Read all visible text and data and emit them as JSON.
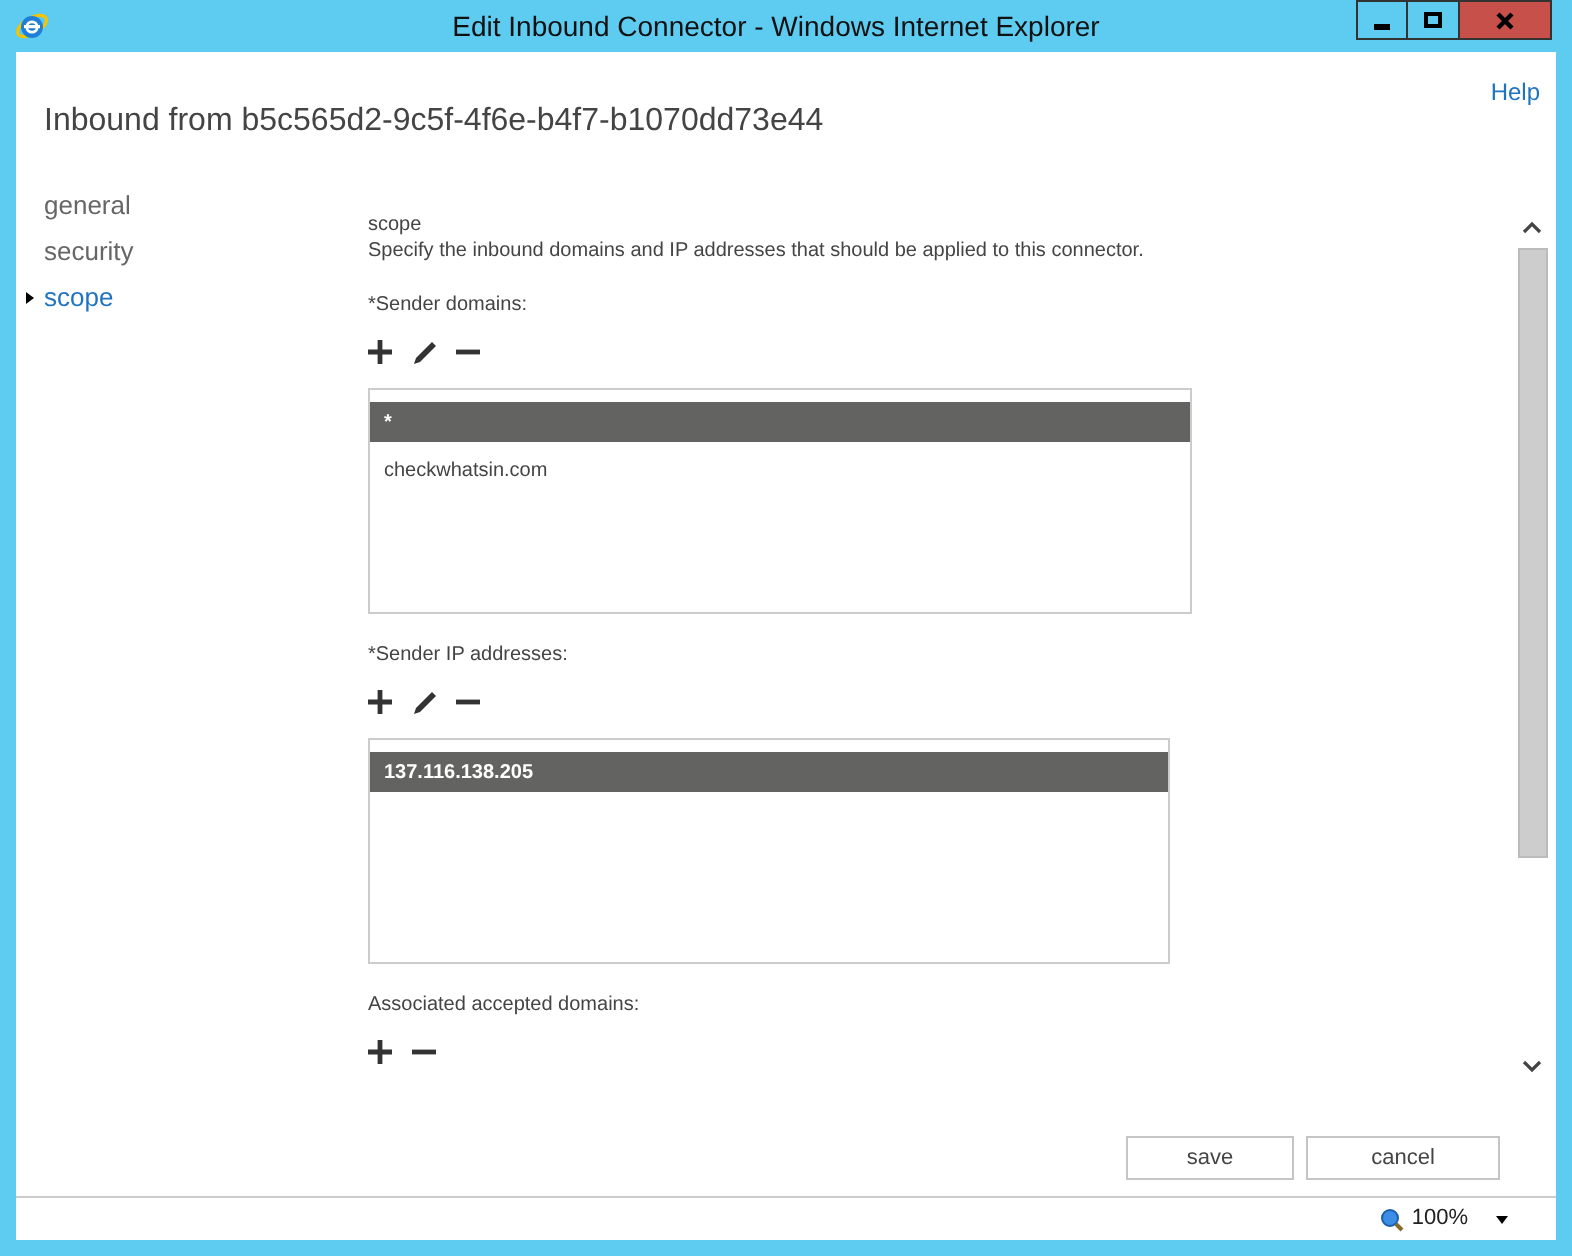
{
  "window": {
    "title": "Edit Inbound Connector - Windows Internet Explorer"
  },
  "help_link": "Help",
  "page_title": "Inbound from b5c565d2-9c5f-4f6e-b4f7-b1070dd73e44",
  "nav": [
    {
      "label": "general",
      "selected": false
    },
    {
      "label": "security",
      "selected": false
    },
    {
      "label": "scope",
      "selected": true
    }
  ],
  "section": {
    "heading": "scope",
    "description": "Specify the inbound domains and IP addresses that should be applied to this connector."
  },
  "groups": [
    {
      "label": "*Sender domains:",
      "tools": [
        {
          "kind": "add"
        },
        {
          "kind": "edit"
        },
        {
          "kind": "remove"
        }
      ],
      "list": {
        "items": [
          {
            "text": "*",
            "selected": true
          },
          {
            "text": "checkwhatsin.com",
            "selected": false
          }
        ]
      }
    },
    {
      "label": "*Sender IP addresses:",
      "tools": [
        {
          "kind": "add"
        },
        {
          "kind": "edit"
        },
        {
          "kind": "remove"
        }
      ],
      "list": {
        "items": [
          {
            "text": "137.116.138.205",
            "selected": true
          }
        ]
      }
    },
    {
      "label": "Associated accepted domains:",
      "tools": [
        {
          "kind": "add"
        },
        {
          "kind": "remove"
        }
      ]
    }
  ],
  "buttons": [
    "save",
    "cancel"
  ],
  "status_bar": {
    "zoom": "100%"
  }
}
